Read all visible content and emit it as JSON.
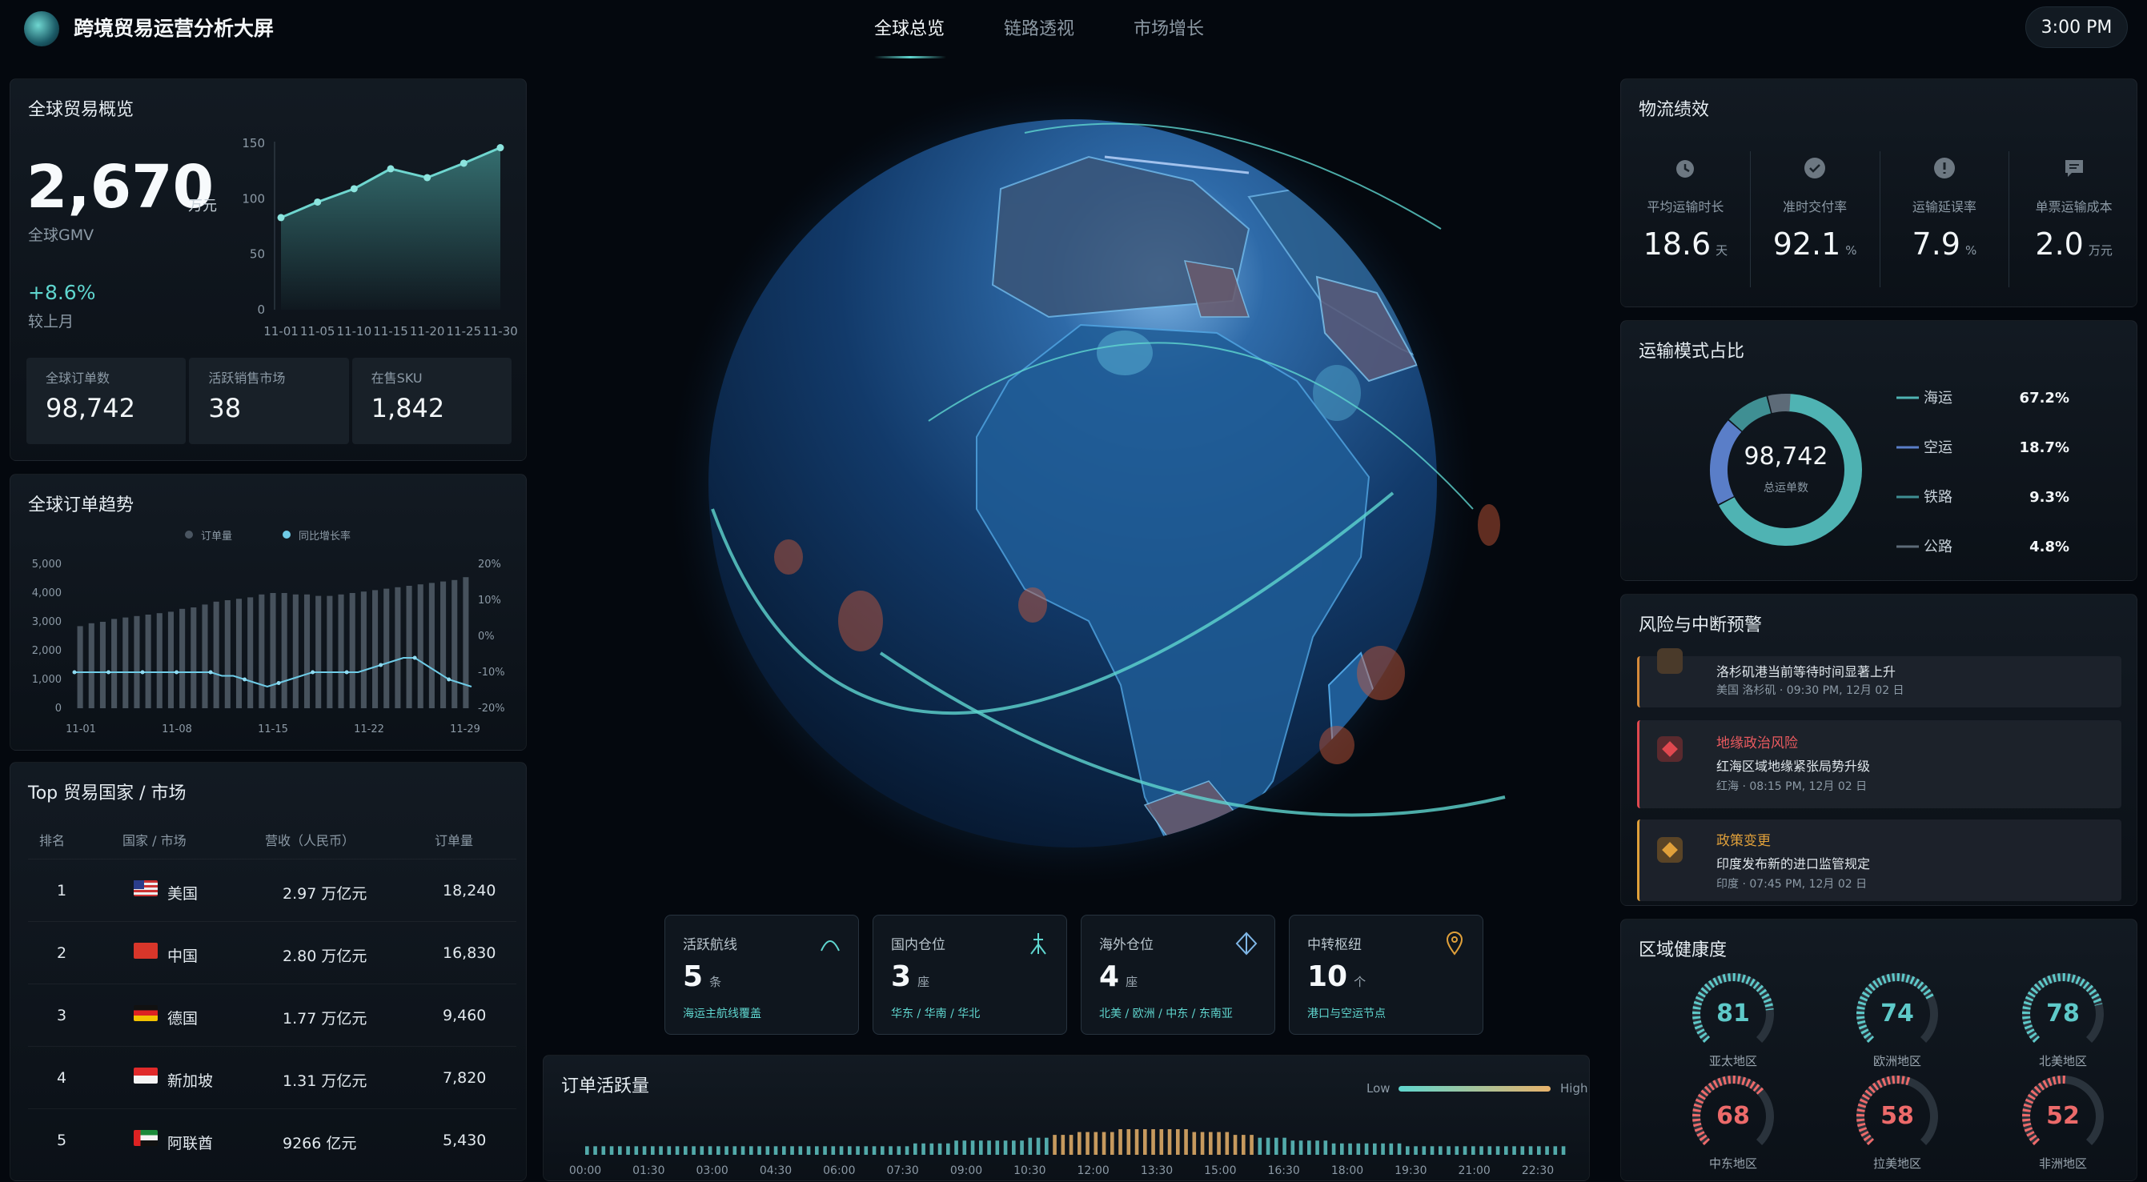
{
  "header": {
    "title": "跨境贸易运营分析大屏",
    "tabs": [
      {
        "label": "全球总览",
        "active": true
      },
      {
        "label": "链路透视",
        "active": false
      },
      {
        "label": "市场增长",
        "active": false
      }
    ],
    "time": "3:00 PM"
  },
  "overview": {
    "title": "全球贸易概览",
    "gmv_value": "2,670",
    "gmv_unit": "万元",
    "gmv_label": "全球GMV",
    "change": "+8.6%",
    "change_label": "较上月",
    "chart_data": {
      "type": "area",
      "x": [
        "11-01",
        "11-05",
        "11-10",
        "11-15",
        "11-20",
        "11-25",
        "11-30"
      ],
      "values": [
        83,
        97,
        109,
        127,
        119,
        132,
        146
      ],
      "ylim": [
        0,
        150
      ],
      "yticks": [
        "150",
        "100",
        "50",
        "0"
      ]
    },
    "stats": [
      {
        "label": "全球订单数",
        "value": "98,742"
      },
      {
        "label": "活跃销售市场",
        "value": "38"
      },
      {
        "label": "在售SKU",
        "value": "1,842"
      }
    ]
  },
  "trend": {
    "title": "全球订单趋势",
    "legend": [
      "订单量",
      "同比增长率"
    ],
    "chart_data": {
      "type": "bar",
      "x_ticks": [
        "11-01",
        "11-08",
        "11-15",
        "11-22",
        "11-29"
      ],
      "y_left_ticks": [
        "5,000",
        "4,000",
        "3,000",
        "2,000",
        "1,000",
        "0"
      ],
      "y_right_ticks": [
        "20%",
        "10%",
        "0%",
        "-10%",
        "-20%"
      ],
      "ylim": [
        0,
        5000
      ],
      "ylim_right": [
        -20,
        20
      ],
      "series": [
        {
          "name": "订单量",
          "values": [
            2850,
            2950,
            3000,
            3100,
            3150,
            3200,
            3250,
            3300,
            3350,
            3450,
            3500,
            3600,
            3700,
            3750,
            3800,
            3850,
            3950,
            4000,
            4000,
            3950,
            3950,
            3900,
            3900,
            3950,
            4000,
            4050,
            4100,
            4150,
            4200,
            4250,
            4300,
            4350,
            4400,
            4450,
            4550
          ]
        },
        {
          "name": "同比增长率",
          "values": [
            -10,
            -10,
            -10,
            -10,
            -10,
            -10,
            -10,
            -10,
            -10,
            -10,
            -10,
            -10,
            -10,
            -11,
            -11,
            -12,
            -13,
            -14,
            -13,
            -12,
            -11,
            -10,
            -10,
            -10,
            -10,
            -10,
            -9,
            -8,
            -7,
            -6,
            -6,
            -8,
            -10,
            -12,
            -13,
            -14
          ]
        }
      ]
    }
  },
  "top_markets": {
    "title": "Top 贸易国家 / 市场",
    "headers": [
      "排名",
      "国家 / 市场",
      "营收（人民币）",
      "订单量"
    ],
    "rows": [
      {
        "rank": "1",
        "country": "美国",
        "revenue": "2.97 万亿元",
        "orders": "18,240",
        "flag": "us"
      },
      {
        "rank": "2",
        "country": "中国",
        "revenue": "2.80 万亿元",
        "orders": "16,830",
        "flag": "cn"
      },
      {
        "rank": "3",
        "country": "德国",
        "revenue": "1.77 万亿元",
        "orders": "9,460",
        "flag": "de"
      },
      {
        "rank": "4",
        "country": "新加坡",
        "revenue": "1.31 万亿元",
        "orders": "7,820",
        "flag": "sg"
      },
      {
        "rank": "5",
        "country": "阿联酋",
        "revenue": "9266 亿元",
        "orders": "5,430",
        "flag": "ae"
      }
    ]
  },
  "kpis": [
    {
      "title": "活跃航线",
      "value": "5",
      "unit": "条",
      "sub": "海运主航线覆盖",
      "icon": "arc-icon"
    },
    {
      "title": "国内仓位",
      "value": "3",
      "unit": "座",
      "sub": "华东 / 华南 / 华北",
      "icon": "tower-icon"
    },
    {
      "title": "海外仓位",
      "value": "4",
      "unit": "座",
      "sub": "北美 / 欧洲 / 中东 / 东南亚",
      "icon": "diamond-icon"
    },
    {
      "title": "中转枢纽",
      "value": "10",
      "unit": "个",
      "sub": "港口与空运节点",
      "icon": "pin-icon"
    }
  ],
  "activity": {
    "title": "订单活跃量",
    "legend_low": "Low",
    "legend_high": "High",
    "chart_data": {
      "type": "bar",
      "x_ticks": [
        "00:00",
        "01:30",
        "03:00",
        "04:30",
        "06:00",
        "07:30",
        "09:00",
        "10:30",
        "12:00",
        "13:30",
        "15:00",
        "16:30",
        "18:00",
        "19:30",
        "21:00",
        "22:30"
      ],
      "values": [
        3,
        3,
        3,
        3,
        3,
        3,
        3,
        3,
        3,
        3,
        3,
        3,
        3,
        3,
        3,
        3,
        3,
        3,
        3,
        3,
        3,
        3,
        3,
        3,
        3,
        3,
        3,
        3,
        3,
        3,
        3,
        3,
        3,
        3,
        3,
        3,
        3,
        3,
        3,
        3,
        4,
        4,
        4,
        4,
        4,
        5,
        5,
        5,
        5,
        5,
        5,
        5,
        5,
        5,
        6,
        6,
        6,
        7,
        7,
        7,
        8,
        8,
        8,
        8,
        8,
        9,
        9,
        9,
        9,
        9,
        9,
        9,
        9,
        9,
        8,
        8,
        8,
        8,
        8,
        7,
        7,
        7,
        6,
        6,
        6,
        6,
        5,
        5,
        5,
        5,
        5,
        4,
        4,
        4,
        4,
        4,
        4,
        4,
        4,
        4,
        3,
        3,
        3,
        3,
        3,
        3,
        3,
        3,
        3,
        3,
        3,
        3,
        3,
        3,
        3,
        3,
        3,
        3,
        3,
        3
      ]
    }
  },
  "logistics": {
    "title": "物流绩效",
    "items": [
      {
        "label": "平均运输时长",
        "value": "18.6",
        "unit": "天",
        "icon": "clock-icon"
      },
      {
        "label": "准时交付率",
        "value": "92.1",
        "unit": "%",
        "icon": "check-icon"
      },
      {
        "label": "运输延误率",
        "value": "7.9",
        "unit": "%",
        "icon": "alert-icon"
      },
      {
        "label": "单票运输成本",
        "value": "2.0",
        "unit": "万元",
        "icon": "message-icon"
      }
    ]
  },
  "modes": {
    "title": "运输模式占比",
    "center_value": "98,742",
    "center_label": "总运单数",
    "chart_data": {
      "type": "pie",
      "categories": [
        "海运",
        "空运",
        "铁路",
        "公路"
      ],
      "values": [
        67.2,
        18.7,
        9.3,
        4.8
      ],
      "labels": [
        "67.2%",
        "18.7%",
        "9.3%",
        "4.8%"
      ],
      "colors": [
        "#4fb3b3",
        "#5a7ec8",
        "#3f8f93",
        "#5d6b78"
      ]
    }
  },
  "risks": {
    "title": "风险与中断预警",
    "items": [
      {
        "title": "",
        "desc": "洛杉矶港当前等待时间显著上升",
        "meta": "美国 洛杉矶 · 09:30 PM, 12月 02 日",
        "color": "#d58a3a"
      },
      {
        "title": "地缘政治风险",
        "desc": "红海区域地缘紧张局势升级",
        "meta": "红海 · 08:15 PM, 12月 02 日",
        "color": "#e0484f"
      },
      {
        "title": "政策变更",
        "desc": "印度发布新的进口监管规定",
        "meta": "印度 · 07:45 PM, 12月 02 日",
        "color": "#e0a03a"
      }
    ]
  },
  "health": {
    "title": "区域健康度",
    "regions": [
      {
        "name": "亚太地区",
        "value": 81,
        "color": "#5ec9c9"
      },
      {
        "name": "欧洲地区",
        "value": 74,
        "color": "#5ec9c9"
      },
      {
        "name": "北美地区",
        "value": 78,
        "color": "#5ec9c9"
      },
      {
        "name": "中东地区",
        "value": 68,
        "color": "#ec6a6a"
      },
      {
        "name": "拉美地区",
        "value": 58,
        "color": "#ec6a6a"
      },
      {
        "name": "非洲地区",
        "value": 52,
        "color": "#ec6a6a"
      }
    ]
  }
}
